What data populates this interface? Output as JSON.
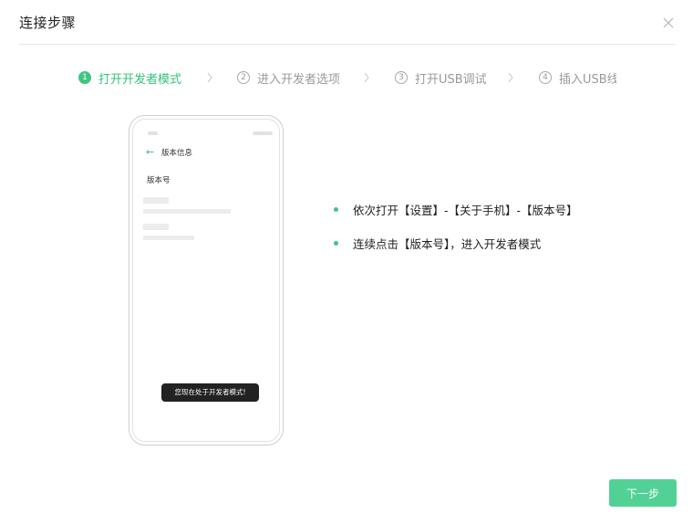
{
  "dialog": {
    "title": "连接步骤",
    "close_icon": "close-icon"
  },
  "steps": [
    {
      "number": "1",
      "label": "打开开发者模式",
      "state": "active"
    },
    {
      "number": "2",
      "label": "进入开发者选项",
      "state": "inactive"
    },
    {
      "number": "3",
      "label": "打开USB调试",
      "state": "inactive"
    },
    {
      "number": "4",
      "label": "插入USB线",
      "state": "inactive"
    }
  ],
  "phone": {
    "back_icon": "arrow-left-icon",
    "header_title": "版本信息",
    "version_label": "版本号",
    "toast": "您现在处于开发者模式!"
  },
  "instructions": [
    "依次打开【设置】-【关于手机】-【版本号】",
    "连续点击【版本号】，进入开发者模式"
  ],
  "footer": {
    "next_label": "下一步"
  },
  "colors": {
    "accent": "#3ec682",
    "button": "#52d196",
    "inactive_text": "#9a9a9a"
  }
}
